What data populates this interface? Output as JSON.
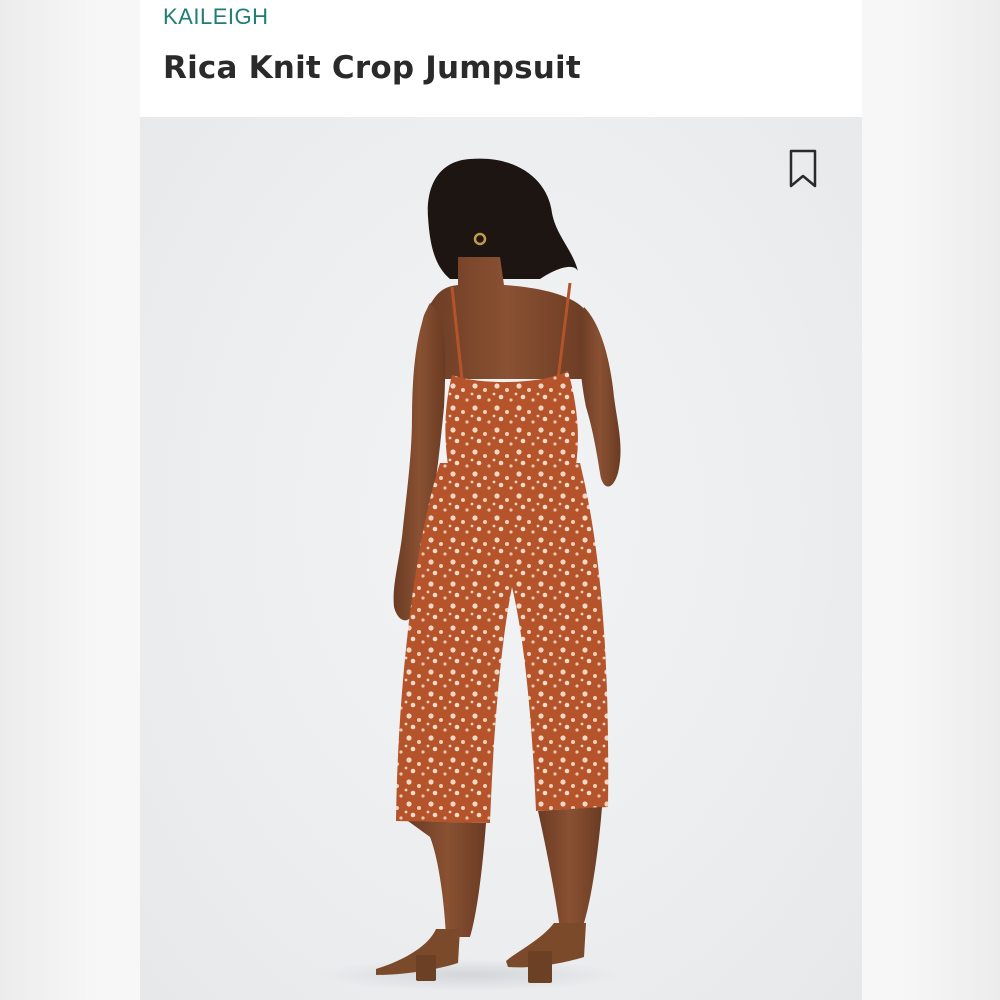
{
  "product": {
    "brand": "KAILEIGH",
    "title": "Rica Knit Crop Jumpsuit"
  },
  "icons": {
    "bookmark": "bookmark-icon"
  },
  "colors": {
    "brand": "#1f7d74",
    "title": "#2a2a2a",
    "jumpsuit": "#b5532a",
    "print": "#f1d7c3"
  }
}
